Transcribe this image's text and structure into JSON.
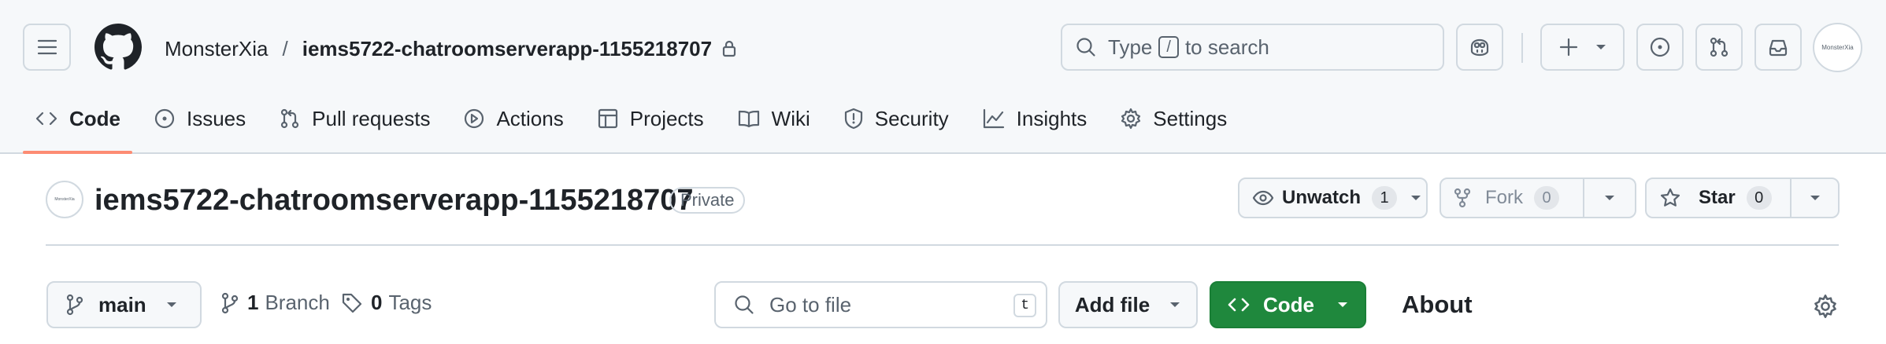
{
  "header": {
    "owner": "MonsterXia",
    "separator": "/",
    "repo": "iems5722-chatroomserverapp-1155218707",
    "search_prefix": "Type",
    "search_key": "/",
    "search_suffix": "to search",
    "avatar_text": "MonsterXia"
  },
  "tabs": [
    {
      "label": "Code",
      "icon": "code-icon"
    },
    {
      "label": "Issues",
      "icon": "issue-icon"
    },
    {
      "label": "Pull requests",
      "icon": "pull-request-icon"
    },
    {
      "label": "Actions",
      "icon": "play-icon"
    },
    {
      "label": "Projects",
      "icon": "table-icon"
    },
    {
      "label": "Wiki",
      "icon": "book-icon"
    },
    {
      "label": "Security",
      "icon": "shield-icon"
    },
    {
      "label": "Insights",
      "icon": "graph-icon"
    },
    {
      "label": "Settings",
      "icon": "gear-icon"
    }
  ],
  "repo_header": {
    "title": "iems5722-chatroomserverapp-1155218707",
    "visibility": "Private",
    "avatar_text": "MonsterXia",
    "watch_label": "Unwatch",
    "watch_count": "1",
    "fork_label": "Fork",
    "fork_count": "0",
    "star_label": "Star",
    "star_count": "0"
  },
  "toolbar": {
    "branch": "main",
    "branch_count": "1",
    "branch_label": "Branch",
    "tag_count": "0",
    "tag_label": "Tags",
    "goto_placeholder": "Go to file",
    "goto_key": "t",
    "add_file_label": "Add file",
    "code_label": "Code",
    "about_heading": "About"
  },
  "colors": {
    "accent_underline": "#fd8c73",
    "code_button": "#1f883d",
    "topbar_bg": "#f6f8fa",
    "border": "#d1d9e0"
  }
}
